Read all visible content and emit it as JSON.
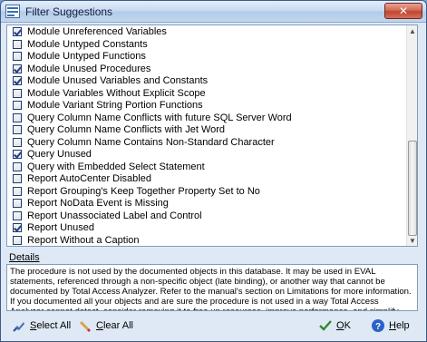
{
  "window": {
    "title": "Filter Suggestions",
    "close_glyph": "✕"
  },
  "list": {
    "items": [
      {
        "label": "Module Unreferenced Variables",
        "checked": true
      },
      {
        "label": "Module Untyped Constants",
        "checked": false
      },
      {
        "label": "Module Untyped Functions",
        "checked": false
      },
      {
        "label": "Module Unused Procedures",
        "checked": true
      },
      {
        "label": "Module Unused Variables and Constants",
        "checked": true
      },
      {
        "label": "Module Variables Without Explicit Scope",
        "checked": false
      },
      {
        "label": "Module Variant String Portion Functions",
        "checked": false
      },
      {
        "label": "Query Column Name Conflicts with future SQL Server Word",
        "checked": false
      },
      {
        "label": "Query Column Name Conflicts with Jet Word",
        "checked": false
      },
      {
        "label": "Query Column Name Contains Non-Standard Character",
        "checked": false
      },
      {
        "label": "Query Unused",
        "checked": true
      },
      {
        "label": "Query with Embedded Select Statement",
        "checked": false
      },
      {
        "label": "Report AutoCenter Disabled",
        "checked": false
      },
      {
        "label": "Report Grouping's Keep Together Property Set to No",
        "checked": false
      },
      {
        "label": "Report NoData Event is Missing",
        "checked": false
      },
      {
        "label": "Report Unassociated Label and Control",
        "checked": false
      },
      {
        "label": "Report Unused",
        "checked": true
      },
      {
        "label": "Report Without a Caption",
        "checked": false
      }
    ],
    "scroll_up_glyph": "▲",
    "scroll_down_glyph": "▼"
  },
  "details": {
    "label": "Details",
    "text": "The procedure is not used by the documented objects in this database. It may be used in EVAL statements, referenced through a non-specific object (late binding), or another way that cannot be documented by Total Access Analyzer. Refer to the manual's section on Limitations for more information. If you documented all your objects and are sure the procedure is not used in a way Total Access Analyzer cannot detect, consider removing it to free up resources, improve performance, and simplify code maintenance."
  },
  "buttons": {
    "select_all": {
      "mnemonic": "S",
      "rest": "elect All"
    },
    "clear_all": {
      "mnemonic": "C",
      "rest": "lear All"
    },
    "ok": {
      "mnemonic": "O",
      "rest": "K"
    },
    "help": {
      "mnemonic": "H",
      "rest": "elp"
    }
  },
  "colors": {
    "check": "#1f3f8a",
    "ok_check": "#2e8b2e",
    "help_blue": "#2a62c9",
    "clear_red": "#c0392b"
  }
}
